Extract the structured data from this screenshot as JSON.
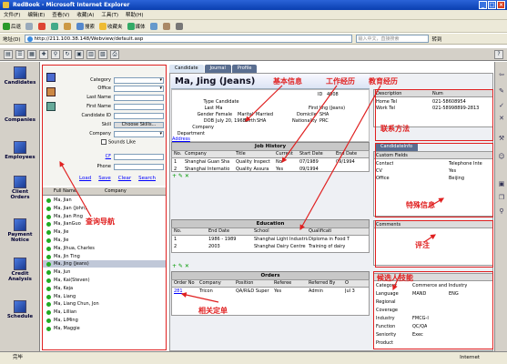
{
  "window": {
    "title": "RedBook - Microsoft Internet Explorer"
  },
  "menu": [
    "文件(F)",
    "编辑(E)",
    "查看(V)",
    "收藏(A)",
    "工具(T)",
    "帮助(H)"
  ],
  "toolbar": {
    "back": "后退",
    "search": "搜索",
    "favorites": "收藏夹",
    "media": "媒体"
  },
  "address": {
    "label": "地址(D)",
    "url": "http://211.100.38.148/Webview/default.asp",
    "search_placeholder": "输入中文，直接搜索",
    "go": "转到"
  },
  "nav": [
    "Candidates",
    "Companies",
    "Employees",
    "Client Orders",
    "Payment Notice",
    "Credit Analysis",
    "Schedule"
  ],
  "search_form": {
    "labels": [
      "Category",
      "Office",
      "Last Name",
      "First Name",
      "Candidate ID",
      "Skill",
      "Company",
      "Sounds Like",
      "CF",
      "Phone"
    ],
    "skill_button": "Choose Skills...",
    "links": [
      "Load",
      "Save",
      "Clear",
      "Search"
    ]
  },
  "people_list": {
    "headers": [
      "Full Name",
      "Company"
    ],
    "names": [
      "Ma, Jian",
      "Ma, Jian (John)",
      "Ma, Jian Ping",
      "Ma, JianGuo",
      "Ma, Jie",
      "Ma, Jie",
      "Ma, Jihua, Charles",
      "Ma, Jin Ting",
      "Ma, Jing (Jeans)",
      "Ma, Jun",
      "Ma, Kai(Steven)",
      "Ma, Keja",
      "Ma, Liang",
      "Ma, Liang Chun, Jon",
      "Ma, Lillian",
      "Ma, LiMing",
      "Ma, Maggie"
    ],
    "selected_index": 8
  },
  "tabs": [
    "Candidate",
    "Journal",
    "Profile"
  ],
  "candidate": {
    "name": "Ma, Jing (Jeans)",
    "id_label": "ID",
    "id": "4008",
    "fields": [
      {
        "label": "Type",
        "value": "Candidate"
      },
      {
        "label": "Last",
        "value": "Ma"
      },
      {
        "label": "Gender",
        "value": "Female"
      },
      {
        "label": "DOB",
        "value": "July 20, 1968"
      },
      {
        "label": "Company",
        "value": ""
      },
      {
        "label": "Department",
        "value": ""
      },
      {
        "label": "Address",
        "value": ""
      }
    ],
    "first_label": "First",
    "first": "Jing (Jeans)",
    "marital_label": "Marital",
    "marital": "Married",
    "birth_label": "Birth",
    "birth": "SHA",
    "domicile_label": "Domicile",
    "domicile": "SHA",
    "nationality_label": "Nationality",
    "nationality": "PRC"
  },
  "job_history": {
    "title": "Job History",
    "headers": [
      "No.",
      "Company",
      "Title",
      "Current",
      "Start Date",
      "End Date"
    ],
    "rows": [
      [
        "1",
        "Shanghai Guan Sha",
        "Quality Inspect",
        "No",
        "07/1989",
        "09/1994"
      ],
      [
        "2",
        "Shanghai Internatio",
        "Quality Assura",
        "Yes",
        "09/1994",
        ""
      ]
    ]
  },
  "education": {
    "title": "Education",
    "headers": [
      "No.",
      "End Date",
      "School",
      "Qualificati"
    ],
    "rows": [
      [
        "1",
        "1986 - 1989",
        "Shanghai Light Industrial Colle",
        "Diploma in Food T"
      ],
      [
        "2",
        "2003",
        "Shanghai Dairy Centre",
        "Training of dairy"
      ]
    ]
  },
  "orders": {
    "title": "Orders",
    "headers": [
      "Order No",
      "Company",
      "Position",
      "Referee",
      "Referred By",
      "O"
    ],
    "rows": [
      [
        "281",
        "Tricon",
        "QA/R&D Super",
        "Yes",
        "Admin",
        "Jul 3"
      ]
    ]
  },
  "contact": {
    "headers": [
      "Description",
      "Num"
    ],
    "rows": [
      [
        "Home Tel",
        "021-58608954"
      ],
      [
        "Work Tel",
        "021-58998899-2813"
      ]
    ]
  },
  "candidate_info": {
    "tab": "CandidateInfo",
    "custom_label": "Custom Fields",
    "rows": [
      [
        "Contact",
        "Telephone Inte"
      ],
      [
        "CV",
        "Yes"
      ],
      [
        "Office",
        "Beijing"
      ]
    ]
  },
  "comments": {
    "label": "Comments"
  },
  "skills": {
    "rows": [
      [
        "Category",
        "Commerce and Industry"
      ],
      [
        "Language",
        "MAND",
        "ENG"
      ],
      [
        "Regional",
        ""
      ],
      [
        "Coverage",
        ""
      ],
      [
        "Industry",
        "FMCG-I"
      ],
      [
        "Function",
        "QC/QA"
      ],
      [
        "Seniority",
        "Exec"
      ],
      [
        "Product",
        ""
      ]
    ]
  },
  "annotations": {
    "basic": "基本信息",
    "work": "工作经历",
    "edu": "教育经历",
    "contact": "联系方法",
    "special": "特殊信息",
    "comment": "评注",
    "skill": "候选人技能",
    "order": "相关定单",
    "nav": "查询导航"
  },
  "status": {
    "left": "完毕",
    "right": "Internet"
  }
}
